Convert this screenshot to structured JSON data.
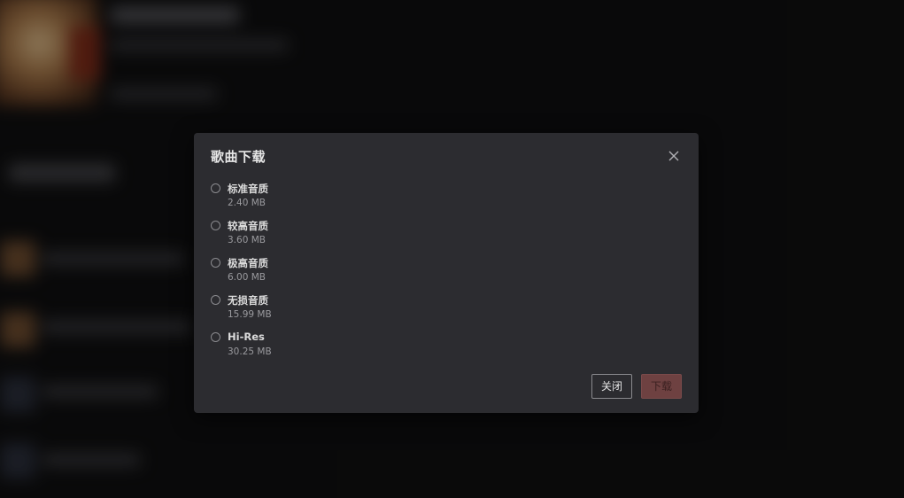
{
  "dialog": {
    "title": "歌曲下载",
    "close_icon": "close-icon",
    "options": [
      {
        "label": "标准音质",
        "size": "2.40 MB"
      },
      {
        "label": "较高音质",
        "size": "3.60 MB"
      },
      {
        "label": "极高音质",
        "size": "6.00 MB"
      },
      {
        "label": "无损音质",
        "size": "15.99 MB"
      },
      {
        "label": "Hi-Res",
        "size": "30.25 MB"
      }
    ],
    "close_button": "关闭",
    "download_button": "下载"
  },
  "colors": {
    "dialog_bg": "#2c2c30",
    "download_button_bg": "#6e4141",
    "page_bg": "#0f0f10"
  }
}
